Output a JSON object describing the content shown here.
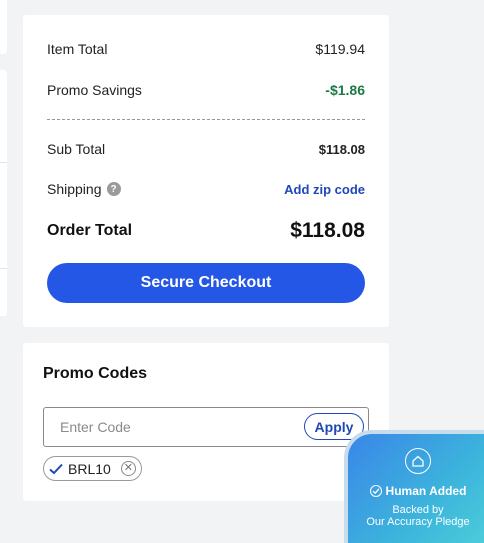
{
  "summary": {
    "item_total_label": "Item Total",
    "item_total_value": "$119.94",
    "promo_savings_label": "Promo Savings",
    "promo_savings_value": "-$1.86",
    "sub_total_label": "Sub Total",
    "sub_total_value": "$118.08",
    "shipping_label": "Shipping",
    "shipping_help": "?",
    "shipping_link": "Add zip code",
    "order_total_label": "Order Total",
    "order_total_value": "$118.08",
    "checkout_label": "Secure Checkout"
  },
  "promo": {
    "title": "Promo Codes",
    "input_placeholder": "Enter Code",
    "input_value": "",
    "apply_label": "Apply",
    "applied_code": "BRL10"
  },
  "badge": {
    "title": "Human Added",
    "line1": "Backed by",
    "line2": "Our Accuracy Pledge"
  },
  "colors": {
    "accent": "#2457e6",
    "link": "#1f47b8",
    "savings": "#1e7a45",
    "background": "#f2f3f5"
  },
  "icons": {
    "help": "question-circle-icon",
    "check": "checkmark-icon",
    "remove": "close-circle-icon",
    "home": "home-icon",
    "badge_check": "check-circle-icon"
  }
}
